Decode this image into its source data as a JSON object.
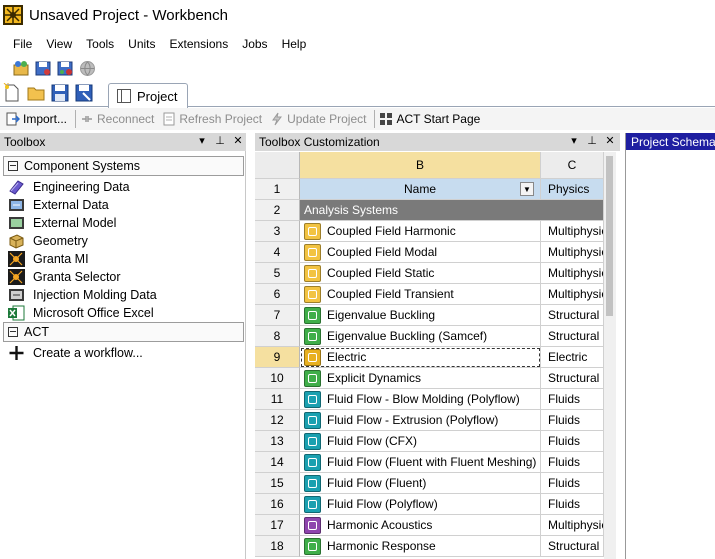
{
  "window": {
    "title": "Unsaved Project - Workbench"
  },
  "menu": [
    "File",
    "View",
    "Tools",
    "Units",
    "Extensions",
    "Jobs",
    "Help"
  ],
  "tabs": {
    "project": "Project"
  },
  "command_bar": {
    "import": "Import...",
    "reconnect": "Reconnect",
    "refresh": "Refresh Project",
    "update": "Update Project",
    "act_start": "ACT Start Page"
  },
  "toolbox": {
    "title": "Toolbox",
    "controls": {
      "dropdown": "▾",
      "pin": "⊥",
      "close": "✕"
    },
    "groups": [
      {
        "label": "Component Systems",
        "items": [
          {
            "label": "Engineering Data",
            "icon": "engineering-data-icon"
          },
          {
            "label": "External Data",
            "icon": "external-data-icon"
          },
          {
            "label": "External Model",
            "icon": "external-model-icon"
          },
          {
            "label": "Geometry",
            "icon": "geometry-icon"
          },
          {
            "label": "Granta MI",
            "icon": "granta-mi-icon"
          },
          {
            "label": "Granta Selector",
            "icon": "granta-selector-icon"
          },
          {
            "label": "Injection Molding Data",
            "icon": "injection-molding-icon"
          },
          {
            "label": "Microsoft Office Excel",
            "icon": "excel-icon"
          }
        ]
      },
      {
        "label": "ACT",
        "items": [
          {
            "label": "Create a workflow...",
            "icon": "plus-icon"
          }
        ]
      }
    ]
  },
  "customization": {
    "title": "Toolbox Customization",
    "controls": {
      "dropdown": "▾",
      "pin": "⊥",
      "close": "✕"
    },
    "col_b": "B",
    "col_c": "C",
    "header_name": "Name",
    "header_physics": "Physics",
    "row1": "1",
    "row2": "2",
    "analysis_systems": "Analysis Systems",
    "rows": [
      {
        "num": "3",
        "name": "Coupled Field Harmonic",
        "physics": "Multiphysics",
        "icon": "coupled-field-icon",
        "color": "#f2c341"
      },
      {
        "num": "4",
        "name": "Coupled Field Modal",
        "physics": "Multiphysics",
        "icon": "coupled-field-icon",
        "color": "#f2c341"
      },
      {
        "num": "5",
        "name": "Coupled Field Static",
        "physics": "Multiphysics",
        "icon": "coupled-field-icon",
        "color": "#f2c341"
      },
      {
        "num": "6",
        "name": "Coupled Field Transient",
        "physics": "Multiphysics",
        "icon": "coupled-field-icon",
        "color": "#f2c341"
      },
      {
        "num": "7",
        "name": "Eigenvalue Buckling",
        "physics": "Structural",
        "icon": "eigenvalue-buckling-icon",
        "color": "#3fae49"
      },
      {
        "num": "8",
        "name": "Eigenvalue Buckling (Samcef)",
        "physics": "Structural",
        "icon": "eigenvalue-buckling-icon",
        "color": "#3fae49"
      },
      {
        "num": "9",
        "name": "Electric",
        "physics": "Electric",
        "icon": "electric-icon",
        "color": "#e8b020"
      },
      {
        "num": "10",
        "name": "Explicit Dynamics",
        "physics": "Structural",
        "icon": "explicit-dynamics-icon",
        "color": "#3fae49"
      },
      {
        "num": "11",
        "name": "Fluid Flow - Blow Molding (Polyflow)",
        "physics": "Fluids",
        "icon": "fluid-flow-icon",
        "color": "#1aa0b0"
      },
      {
        "num": "12",
        "name": "Fluid Flow - Extrusion (Polyflow)",
        "physics": "Fluids",
        "icon": "fluid-flow-icon",
        "color": "#1aa0b0"
      },
      {
        "num": "13",
        "name": "Fluid Flow (CFX)",
        "physics": "Fluids",
        "icon": "fluid-flow-icon",
        "color": "#1aa0b0"
      },
      {
        "num": "14",
        "name": "Fluid Flow (Fluent with Fluent Meshing)",
        "physics": "Fluids",
        "icon": "fluid-flow-icon",
        "color": "#1aa0b0"
      },
      {
        "num": "15",
        "name": "Fluid Flow (Fluent)",
        "physics": "Fluids",
        "icon": "fluid-flow-icon",
        "color": "#1aa0b0"
      },
      {
        "num": "16",
        "name": "Fluid Flow (Polyflow)",
        "physics": "Fluids",
        "icon": "fluid-flow-icon",
        "color": "#1aa0b0"
      },
      {
        "num": "17",
        "name": "Harmonic Acoustics",
        "physics": "Multiphysics",
        "icon": "harmonic-acoustics-icon",
        "color": "#8e44ad"
      },
      {
        "num": "18",
        "name": "Harmonic Response",
        "physics": "Structural",
        "icon": "harmonic-response-icon",
        "color": "#3fae49"
      }
    ],
    "selected_row": "9"
  },
  "schematic": {
    "title": "Project Schematic"
  },
  "colors": {
    "schematic_header": "#1f1fa1",
    "column_header_selected": "#f5e0a0",
    "name_header": "#c7dcef",
    "analysis_row": "#7a7a7a"
  }
}
